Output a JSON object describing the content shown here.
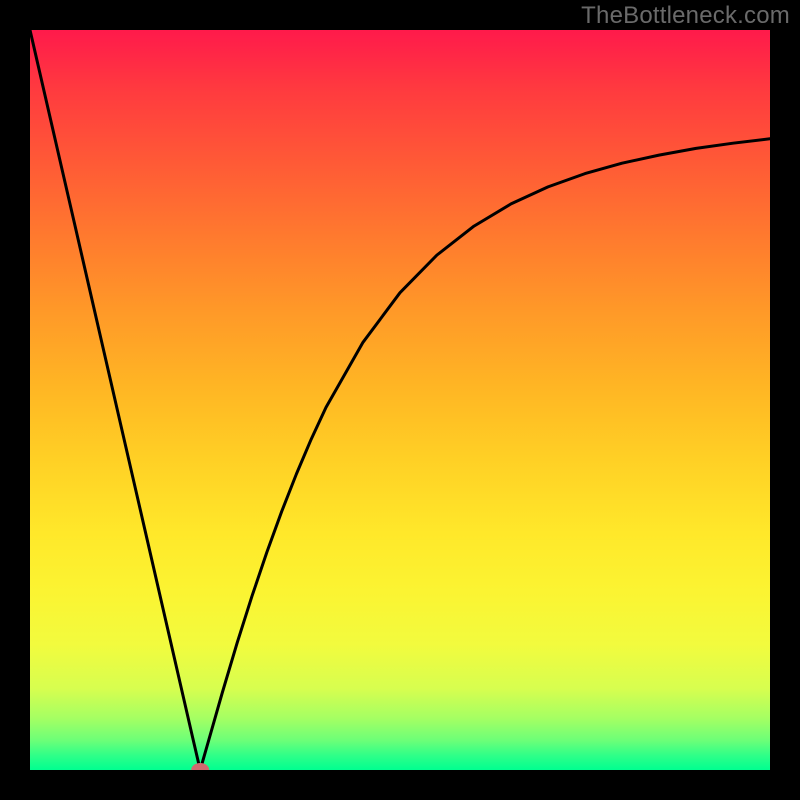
{
  "watermark": "TheBottleneck.com",
  "chart_data": {
    "type": "line",
    "title": "",
    "xlabel": "",
    "ylabel": "",
    "xlim": [
      0,
      100
    ],
    "ylim": [
      0,
      100
    ],
    "grid": false,
    "legend": false,
    "x": [
      0,
      2,
      4,
      6,
      8,
      10,
      12,
      14,
      16,
      18,
      20,
      22,
      23,
      24,
      26,
      28,
      30,
      32,
      34,
      36,
      38,
      40,
      45,
      50,
      55,
      60,
      65,
      70,
      75,
      80,
      85,
      90,
      95,
      100
    ],
    "values": [
      100,
      91.3,
      82.6,
      73.9,
      65.2,
      56.5,
      47.8,
      39.1,
      30.4,
      21.7,
      13.0,
      4.3,
      0.0,
      3.5,
      10.5,
      17.2,
      23.5,
      29.4,
      34.9,
      40.0,
      44.7,
      49.0,
      57.8,
      64.5,
      69.6,
      73.5,
      76.5,
      78.8,
      80.6,
      82.0,
      83.1,
      84.0,
      84.7,
      85.3
    ],
    "marker": {
      "x": 23,
      "y": 0.0
    },
    "colors": {
      "gradient_top": "#ff1a4b",
      "gradient_bottom": "#00ff90",
      "curve": "#000000",
      "marker": "#cf6a6f",
      "background": "#000000"
    }
  }
}
